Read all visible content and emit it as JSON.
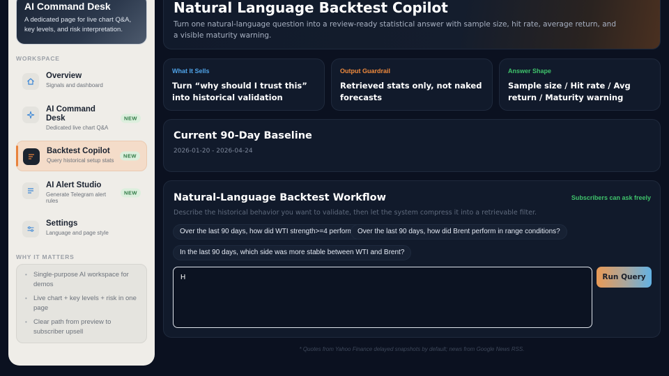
{
  "sidebar": {
    "hero": {
      "title": "AI Command Desk",
      "subtitle": "A dedicated page for live chart Q&A, key levels, and risk interpretation."
    },
    "workspace_label": "WORKSPACE",
    "items": [
      {
        "title": "Overview",
        "subtitle": "Signals and dashboard",
        "badge": "",
        "icon": "home-icon"
      },
      {
        "title": "AI Command Desk",
        "subtitle": "Dedicated live chart Q&A",
        "badge": "NEW",
        "icon": "sparkle-icon"
      },
      {
        "title": "Backtest Copilot",
        "subtitle": "Query historical setup stats",
        "badge": "NEW",
        "icon": "backtest-icon",
        "active": true
      },
      {
        "title": "AI Alert Studio",
        "subtitle": "Generate Telegram alert rules",
        "badge": "NEW",
        "icon": "alert-rules-icon"
      },
      {
        "title": "Settings",
        "subtitle": "Language and page style",
        "badge": "",
        "icon": "sliders-icon"
      }
    ],
    "why_label": "WHY IT MATTERS",
    "why_points": [
      "Single-purpose AI workspace for demos",
      "Live chart + key levels + risk in one page",
      "Clear path from preview to subscriber upsell"
    ]
  },
  "header": {
    "title": "Natural Language Backtest Copilot",
    "description": "Turn one natural-language question into a review-ready statistical answer with sample size, hit rate, average return, and a visible maturity warning."
  },
  "info_cards": [
    {
      "label": "What It Sells",
      "label_color": "#4fa3e8",
      "text": "Turn “why should I trust this” into historical validation"
    },
    {
      "label": "Output Guardrail",
      "label_color": "#f08a3c",
      "text": "Retrieved stats only, not naked forecasts"
    },
    {
      "label": "Answer Shape",
      "label_color": "#3fc26b",
      "text": "Sample size / Hit rate / Avg return / Maturity warning"
    }
  ],
  "baseline": {
    "title": "Current 90-Day Baseline",
    "date_range": "2026-01-20 - 2026-04-24"
  },
  "workflow": {
    "title": "Natural-Language Backtest Workflow",
    "status": "Subscribers can ask freely",
    "description": "Describe the historical behavior you want to validate, then let the system compress it into a retrievable filter.",
    "suggestions": [
      "Over the last 90 days, how did WTI strength>=4 perform?",
      "Over the last 90 days, how did Brent perform in range conditions?",
      "In the last 90 days, which side was more stable between WTI and Brent?"
    ],
    "query_value": "H",
    "run_label": "Run Query"
  },
  "footnote": "* Quotes from Yahoo Finance delayed snapshots by default; news from Google News RSS."
}
